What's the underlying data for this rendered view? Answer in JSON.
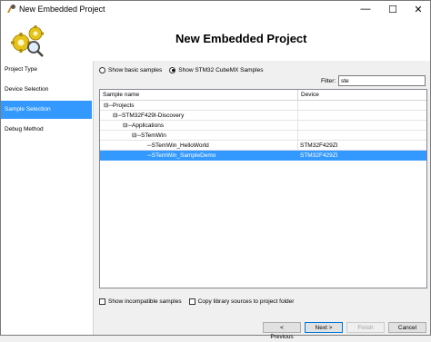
{
  "window": {
    "title": "New Embedded Project",
    "minimize_glyph": "—",
    "maximize_glyph": "☐",
    "close_glyph": "✕",
    "icons": {
      "app": "embedded-project-icon",
      "logo": "gears-magnifier-icon"
    }
  },
  "header": {
    "title": "New Embedded Project"
  },
  "sidebar": {
    "items": [
      {
        "label": "Project Type",
        "active": false
      },
      {
        "label": "Device Selection",
        "active": false
      },
      {
        "label": "Sample Selection",
        "active": true
      },
      {
        "label": "Debug Method",
        "active": false
      }
    ]
  },
  "options": {
    "radio_basic": "Show basic samples",
    "radio_cubemx": "Show STM32 CubeMX Samples",
    "selected_radio": "cubemx",
    "filter_label": "Filter:",
    "filter_value": "ste"
  },
  "table": {
    "headers": {
      "name": "Sample name",
      "device": "Device"
    },
    "rows": [
      {
        "name": "⊟─Projects",
        "device": "",
        "selected": false
      },
      {
        "name": "⊟─STM32F429I-Discovery",
        "device": "",
        "selected": false
      },
      {
        "name": "⊟─Applications",
        "device": "",
        "selected": false
      },
      {
        "name": "⊟─STemWin",
        "device": "",
        "selected": false
      },
      {
        "name": "─STemWin_HelloWorld",
        "device": "STM32F429ZI",
        "selected": false
      },
      {
        "name": "─STemWin_SampleDemo",
        "device": "STM32F429ZI",
        "selected": true
      }
    ]
  },
  "bottom_options": {
    "show_incompatible": "Show incompatible samples",
    "copy_library": "Copy library sources to project folder"
  },
  "buttons": {
    "previous": "< Previous",
    "next": "Next >",
    "finish": "Finish",
    "cancel": "Cancel"
  },
  "colors": {
    "selection": "#3399ff",
    "window_bg": "#f0f0f0"
  }
}
